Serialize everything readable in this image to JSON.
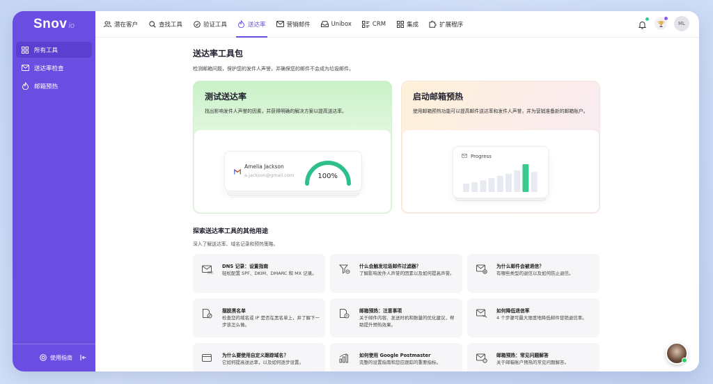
{
  "app": {
    "logo_main": "Snov",
    "logo_sub": "io"
  },
  "sidebar": {
    "items": [
      {
        "label": "所有工具",
        "icon": "grid-icon",
        "active": true
      },
      {
        "label": "送达率检查",
        "icon": "mail-icon",
        "active": false
      },
      {
        "label": "邮箱预热",
        "icon": "flame-icon",
        "active": false
      }
    ],
    "guide_label": "使用指南"
  },
  "topnav": {
    "items": [
      {
        "label": "潜在客户",
        "icon": "users-icon"
      },
      {
        "label": "查找工具",
        "icon": "search-icon"
      },
      {
        "label": "验证工具",
        "icon": "check-circle-icon"
      },
      {
        "label": "送达率",
        "icon": "flame-icon",
        "active": true
      },
      {
        "label": "营销邮件",
        "icon": "mail-icon"
      },
      {
        "label": "Unibox",
        "icon": "inbox-icon"
      },
      {
        "label": "CRM",
        "icon": "crm-icon"
      },
      {
        "label": "集成",
        "icon": "apps-icon"
      },
      {
        "label": "扩展程序",
        "icon": "puzzle-icon"
      }
    ],
    "avatar_initials": "ML"
  },
  "page": {
    "title": "送达率工具包",
    "subtitle": "检测邮箱问题，保护您的发件人声誉，并确保您的邮件不会成为垃圾邮件。"
  },
  "cards": [
    {
      "title": "测试送达率",
      "desc": "找出影响发件人声誉的因素，并获得明确的解决方案以提高送达率。",
      "preview": {
        "name": "Amelia Jackson",
        "email": "a.jackson@gmail.com",
        "score": "100%",
        "score_value": 1.0
      }
    },
    {
      "title": "启动邮箱预热",
      "desc": "使用邮箱预热功能可以提高邮件送达率和发件人声誉，并为营销准备新的邮箱账户。",
      "preview": {
        "label": "Progress",
        "bars": [
          0.3,
          0.35,
          0.42,
          0.5,
          0.58,
          0.66,
          0.78,
          1.0,
          0.72
        ]
      }
    }
  ],
  "explore": {
    "title": "探索送达率工具的其他用途",
    "subtitle": "深入了解送达率、域名记录和预热策略。",
    "tiles": [
      {
        "icon": "dns-icon",
        "title": "DNS 记录：设置指南",
        "desc": "轻松配置 SPF、DKIM、DMARC 和 MX 记录。"
      },
      {
        "icon": "filter-icon",
        "title": "什么会触发垃圾邮件过滤器？",
        "desc": "了解影响发件人声誉的因素以及如何提高声誉。"
      },
      {
        "icon": "mail-bounce-icon",
        "title": "为什么邮件会被退信？",
        "desc": "有哪些类型的退信以及如何防止退信。"
      },
      {
        "icon": "blacklist-icon",
        "title": "摆脱黑名单",
        "desc": "检查您的域名或 IP 是否在黑名单上，并了解下一步该怎么做。"
      },
      {
        "icon": "warmup-icon",
        "title": "邮箱预热：注意事项",
        "desc": "关于邮件内容、发送时机和数量的优化建议，帮助提升预热效果。"
      },
      {
        "icon": "chart-down-icon",
        "title": "如何降低退信率",
        "desc": "4 个步骤可最大限度地降低邮件营销退信率。"
      },
      {
        "icon": "browser-icon",
        "title": "为什么要使用自定义跟踪域名？",
        "desc": "它如何提高送达率，以及如何逐步设置。"
      },
      {
        "icon": "analytics-icon",
        "title": "如何使用 Google Postmaster",
        "desc": "完整的设置指南和您应跟踪的重要指标。"
      },
      {
        "icon": "mail-question-icon",
        "title": "邮箱预热：常见问题解答",
        "desc": "关于邮箱账户预热的常见问题解答。"
      }
    ]
  },
  "colors": {
    "brand": "#6a4ee2",
    "gauge": "#2fbf8a",
    "bar_active": "#3cc98d"
  }
}
